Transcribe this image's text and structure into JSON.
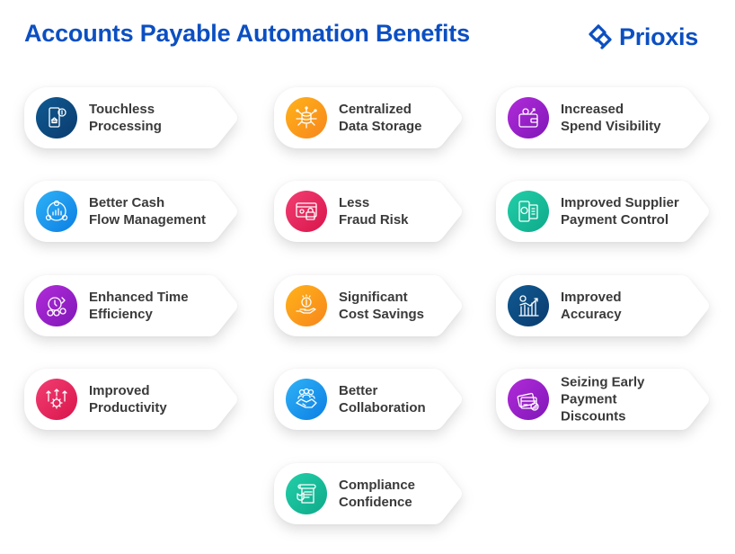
{
  "header": {
    "title": "Accounts Payable Automation Benefits",
    "logo_text": "Prioxis",
    "brand_color": "#0b4fc2"
  },
  "cards": [
    {
      "lines": [
        "Touchless",
        "Processing"
      ],
      "icon": "mobile-payment-icon",
      "color_from": "#0f5a92",
      "color_to": "#0a3b6e"
    },
    {
      "lines": [
        "Centralized",
        "Data Storage"
      ],
      "icon": "database-network-icon",
      "color_from": "#ffb21a",
      "color_to": "#f7861c"
    },
    {
      "lines": [
        "Increased",
        "Spend Visibility"
      ],
      "icon": "wallet-icon",
      "color_from": "#b12bd9",
      "color_to": "#7f17b8"
    },
    {
      "lines": [
        "Better Cash",
        "Flow Management"
      ],
      "icon": "cash-flow-icon",
      "color_from": "#2fb2f7",
      "color_to": "#0b7ee3"
    },
    {
      "lines": [
        "Less",
        "Fraud Risk"
      ],
      "icon": "fraud-lock-icon",
      "color_from": "#f23e72",
      "color_to": "#d8154b"
    },
    {
      "lines": [
        "Improved Supplier",
        "Payment Control"
      ],
      "icon": "supplier-payment-icon",
      "color_from": "#22cfa8",
      "color_to": "#0ea98a"
    },
    {
      "lines": [
        "Enhanced Time",
        "Efficiency"
      ],
      "icon": "time-efficiency-icon",
      "color_from": "#b12bd9",
      "color_to": "#7f17b8"
    },
    {
      "lines": [
        "Significant",
        "Cost Savings"
      ],
      "icon": "coin-hand-icon",
      "color_from": "#ffb21a",
      "color_to": "#f7861c"
    },
    {
      "lines": [
        "Improved",
        "Accuracy"
      ],
      "icon": "chart-growth-icon",
      "color_from": "#0f5a92",
      "color_to": "#0a3b6e"
    },
    {
      "lines": [
        "Improved",
        "Productivity"
      ],
      "icon": "gear-arrows-icon",
      "color_from": "#f23e72",
      "color_to": "#d8154b"
    },
    {
      "lines": [
        "Better",
        "Collaboration"
      ],
      "icon": "handshake-team-icon",
      "color_from": "#2fb2f7",
      "color_to": "#0b7ee3"
    },
    {
      "lines": [
        "Seizing Early",
        "Payment",
        "Discounts"
      ],
      "icon": "card-discount-icon",
      "color_from": "#b12bd9",
      "color_to": "#7f17b8"
    },
    {
      "lines": [
        "Compliance",
        "Confidence"
      ],
      "icon": "compliance-scroll-icon",
      "color_from": "#22cfa8",
      "color_to": "#0ea98a"
    }
  ]
}
